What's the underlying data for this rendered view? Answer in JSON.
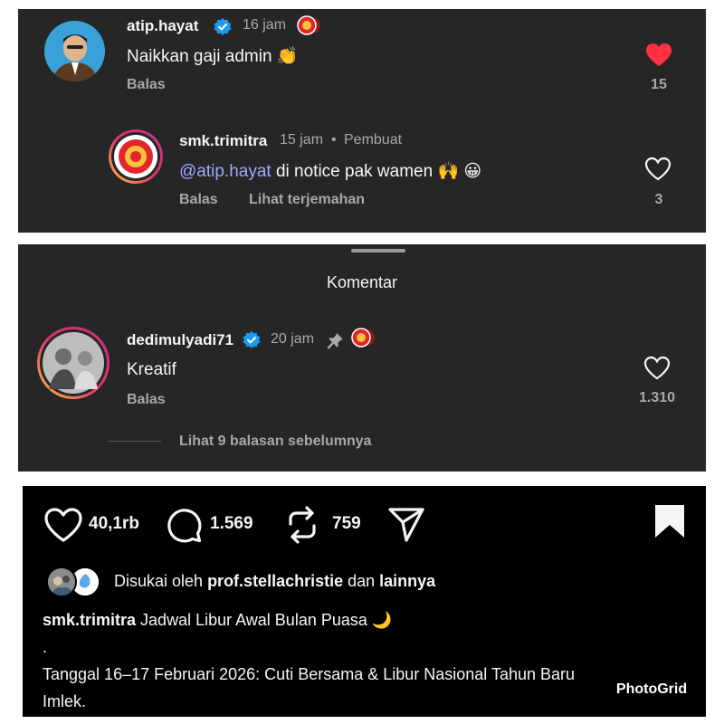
{
  "comment1": {
    "username": "atip.hayat",
    "time": "16 jam",
    "text": "Naikkan gaji admin 👏",
    "reply": "Balas",
    "likes": "15",
    "liked": true
  },
  "reply1": {
    "username": "smk.trimitra",
    "time": "15 jam",
    "separator": "•",
    "role": "Pembuat",
    "mention": "@atip.hayat",
    "text": " di notice pak wamen 🙌 😀",
    "reply": "Balas",
    "translate": "Lihat terjemahan",
    "likes": "3"
  },
  "sheet": {
    "title": "Komentar"
  },
  "comment2": {
    "username": "dedimulyadi71",
    "time": "20 jam",
    "text": "Kreatif",
    "reply": "Balas",
    "likes": "1.310",
    "view_replies": "Lihat 9 balasan sebelumnya"
  },
  "post": {
    "likes": "40,1rb",
    "comments": "1.569",
    "reposts": "759",
    "liked_by_prefix": "Disukai oleh ",
    "liked_by_user": "prof.stellachristie",
    "liked_by_mid": " dan ",
    "liked_by_suffix": "lainnya",
    "caption_user": "smk.trimitra",
    "caption_text": " Jadwal Libur Awal Bulan Puasa 🌙",
    "caption_dot": ".",
    "caption_line3": "Tanggal 16–17 Februari 2026: Cuti Bersama & Libur Nasional Tahun Baru",
    "caption_line4": "Imlek."
  },
  "watermark": "PhotoGrid",
  "colors": {
    "panel_bg": "#262626",
    "post_bg": "#000000",
    "secondary_text": "#a8a8a8",
    "mention": "#9fa8ff",
    "heart_red": "#ff3040",
    "verified_blue": "#1d9bf0"
  }
}
